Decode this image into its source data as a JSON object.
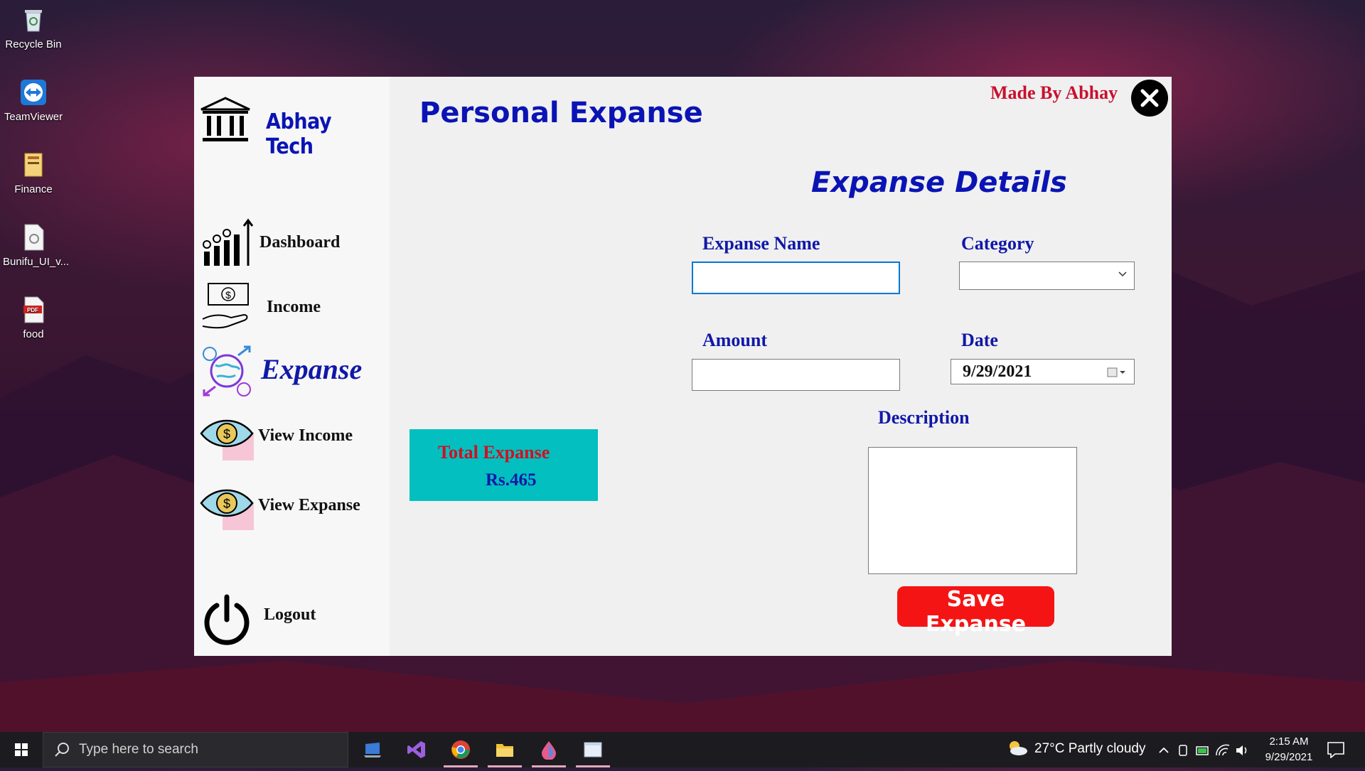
{
  "desktop": {
    "icons": [
      {
        "label": "Recycle Bin",
        "icon": "recycle-bin-icon"
      },
      {
        "label": "TeamViewer",
        "icon": "teamviewer-icon"
      },
      {
        "label": "Finance",
        "icon": "folder-icon"
      },
      {
        "label": "Bunifu_UI_v...",
        "icon": "file-icon"
      },
      {
        "label": "food",
        "icon": "pdf-icon"
      }
    ]
  },
  "app": {
    "brand": "Abhay Tech",
    "title": "Personal Expanse",
    "made_by": "Made By Abhay",
    "sidebar": {
      "items": [
        {
          "label": "Dashboard",
          "icon": "chart-growth-icon"
        },
        {
          "label": "Income",
          "icon": "cash-hand-icon"
        },
        {
          "label": "Expanse",
          "icon": "money-globe-icon",
          "active": true
        },
        {
          "label": "View Income",
          "icon": "eye-dollar-icon"
        },
        {
          "label": "View Expanse",
          "icon": "eye-dollar-icon"
        },
        {
          "label": "Logout",
          "icon": "power-icon"
        }
      ]
    },
    "total": {
      "label": "Total Expanse",
      "value": "Rs.465"
    },
    "form": {
      "section_title": "Expanse Details",
      "expanse_name_label": "Expanse Name",
      "expanse_name_value": "",
      "category_label": "Category",
      "category_value": "",
      "amount_label": "Amount",
      "amount_value": "",
      "date_label": "Date",
      "date_value": "9/29/2021",
      "description_label": "Description",
      "description_value": "",
      "save_label": "Save Expanse"
    }
  },
  "taskbar": {
    "search_placeholder": "Type here to search",
    "weather": "27°C  Partly cloudy",
    "time": "2:15 AM",
    "date": "9/29/2021"
  },
  "colors": {
    "accent_blue": "#0a14b4",
    "label_red": "#c8102e",
    "total_bg": "#03bfbf",
    "save_bg": "#f51414"
  }
}
